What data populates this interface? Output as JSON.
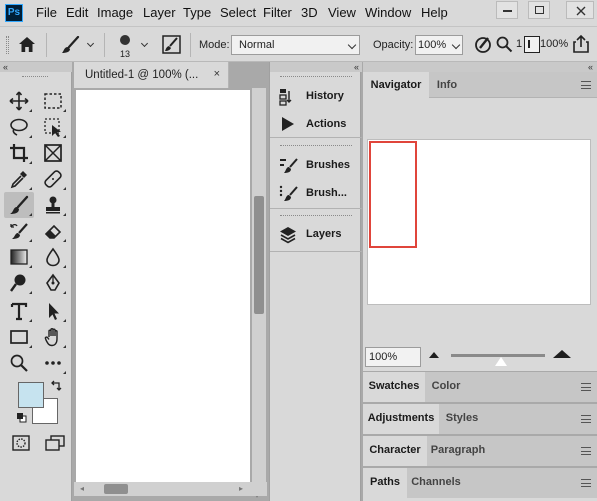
{
  "app": {
    "logo": "Ps"
  },
  "menu": [
    "File",
    "Edit",
    "Image",
    "Layer",
    "Type",
    "Select",
    "Filter",
    "3D",
    "View",
    "Window",
    "Help"
  ],
  "options_bar": {
    "brush_size": "13",
    "mode_label": "Mode:",
    "mode_value": "Normal",
    "opacity_label": "Opacity:",
    "opacity_value": "100%",
    "flow_value": "100%",
    "size_partial": "1"
  },
  "toolbox": {
    "collapse_glyph": "«",
    "tools": [
      "move-tool",
      "marquee-tool",
      "lasso-tool",
      "object-select-tool",
      "crop-tool",
      "frame-tool",
      "eyedropper-tool",
      "healing-brush-tool",
      "brush-tool",
      "stamp-tool",
      "history-brush-tool",
      "eraser-tool",
      "gradient-tool",
      "blur-tool",
      "dodge-tool",
      "pen-tool",
      "type-tool",
      "path-select-tool",
      "rectangle-tool",
      "hand-tool",
      "zoom-tool",
      "more-tools"
    ],
    "foreground_color": "#c6e3ef",
    "background_color": "#ffffff"
  },
  "document": {
    "tab_title": "Untitled-1 @ 100% (...",
    "close_glyph": "×"
  },
  "dock": {
    "collapse_glyph": "«",
    "items": [
      {
        "label": "History",
        "icon": "history-icon"
      },
      {
        "label": "Actions",
        "icon": "play-icon"
      },
      {
        "label": "Brushes",
        "icon": "brushes-icon"
      },
      {
        "label": "Brush...",
        "icon": "brush-settings-icon"
      },
      {
        "label": "Layers",
        "icon": "layers-icon"
      }
    ]
  },
  "panels": {
    "collapse_glyph": "«",
    "groups": [
      {
        "tabs": [
          "Navigator",
          "Info"
        ],
        "active": 0
      },
      {
        "tabs": [
          "Swatches",
          "Color"
        ],
        "active": 0
      },
      {
        "tabs": [
          "Adjustments",
          "Styles"
        ],
        "active": 0
      },
      {
        "tabs": [
          "Character",
          "Paragraph"
        ],
        "active": 0
      },
      {
        "tabs": [
          "Paths",
          "Channels"
        ],
        "active": 0
      }
    ],
    "navigator_zoom": "100%",
    "navigator_zoom_slider": 0.5
  },
  "colors": {
    "accent_red": "#e0453b",
    "ui_gray": "#d9d9d9",
    "workspace_gray": "#a9a9a9"
  }
}
